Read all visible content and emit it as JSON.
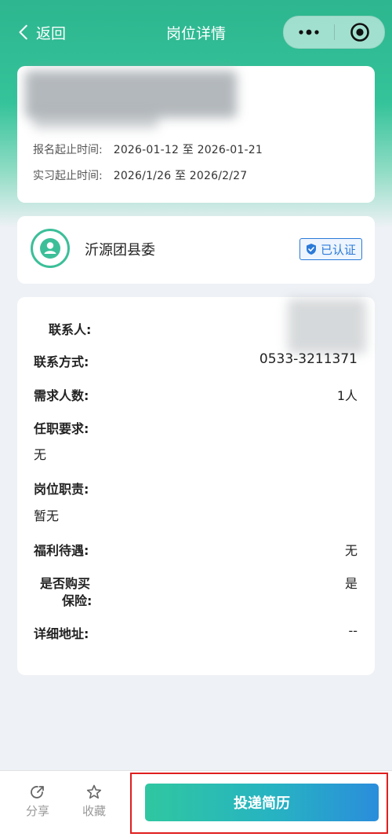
{
  "nav": {
    "back_label": "返回",
    "title": "岗位详情"
  },
  "dates": {
    "signup_label": "报名起止时间:",
    "signup_value": "2026-01-12 至 2026-01-21",
    "intern_label": "实习起止时间:",
    "intern_value": "2026/1/26 至 2026/2/27"
  },
  "org": {
    "name": "沂源团县委",
    "badge": "已认证"
  },
  "details": {
    "contact_person_label": "联系人:",
    "contact_method_label": "联系方式:",
    "contact_method_value": "0533-3211371",
    "headcount_label": "需求人数:",
    "headcount_value": "1人",
    "requirements_label": "任职要求:",
    "requirements_value": "无",
    "duties_label": "岗位职责:",
    "duties_value": "暂无",
    "benefits_label": "福利待遇:",
    "benefits_value": "无",
    "insurance_label_1": "是否购买",
    "insurance_label_2": "保险:",
    "insurance_value": "是",
    "address_label": "详细地址:",
    "address_value": "--"
  },
  "bottom": {
    "share_label": "分享",
    "favorite_label": "收藏",
    "submit_label": "投递简历"
  },
  "colors": {
    "accent": "#34c39a",
    "verified_blue": "#2b7ad8",
    "highlight_red": "#e01e1e"
  }
}
